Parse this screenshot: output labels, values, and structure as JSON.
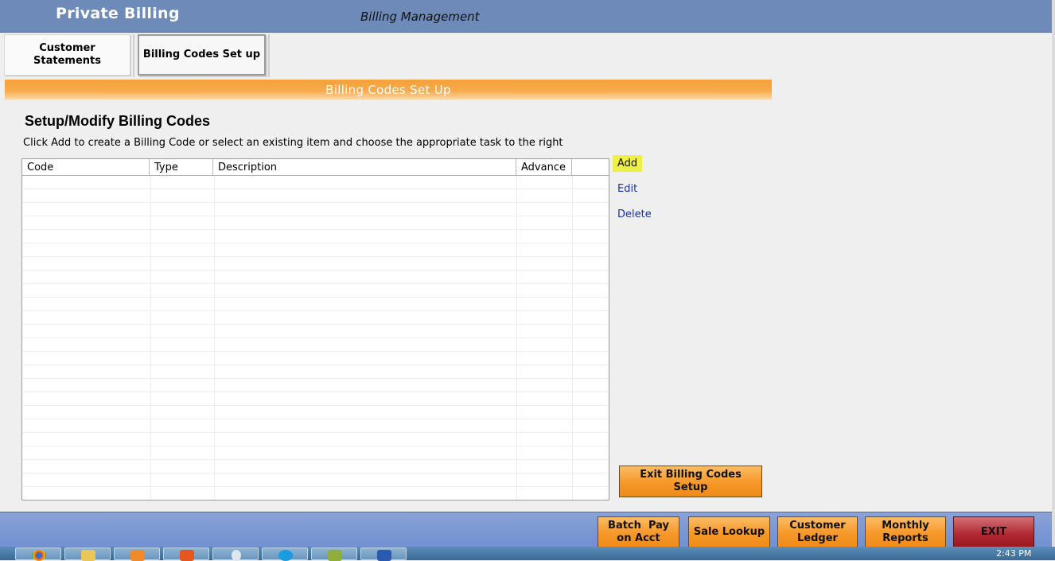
{
  "header": {
    "app_title": "Private Billing",
    "module_title": "Billing Management"
  },
  "tabs": [
    {
      "label": "Customer Statements",
      "line1": "Customer",
      "line2": "Statements",
      "active": false
    },
    {
      "label": "Billing Codes Set up",
      "active": true
    }
  ],
  "section": {
    "banner": "Billing Codes Set Up"
  },
  "page": {
    "heading": "Setup/Modify Billing Codes",
    "instructions": "Click Add to create a Billing Code or select an existing item and choose the appropriate task to the right"
  },
  "grid": {
    "columns": [
      "Code",
      "Type",
      "Description",
      "Advance",
      ""
    ],
    "rows": []
  },
  "actions": {
    "add": "Add",
    "edit": "Edit",
    "delete": "Delete"
  },
  "exit_codes_button": {
    "line1": "Exit Billing Codes",
    "line2": "Setup"
  },
  "footer_buttons": {
    "batch_pay": {
      "line1": "Batch  Pay",
      "line2": "on Acct"
    },
    "sale_lookup": {
      "line1": "Sale Lookup"
    },
    "customer_ledger": {
      "line1": "Customer",
      "line2": "Ledger"
    },
    "monthly_reports": {
      "line1": "Monthly",
      "line2": "Reports"
    },
    "exit": {
      "line1": "EXIT"
    }
  },
  "taskbar": {
    "clock": "2:43 PM",
    "icons": [
      "chrome-icon",
      "explorer-icon",
      "media-player-icon",
      "app-b-icon",
      "search-icon",
      "skype-icon",
      "fen-icon",
      "word-icon"
    ]
  },
  "colors": {
    "header": "#6d8ab9",
    "banner": "#f6a13a",
    "button_orange": "#f69a2c",
    "exit_red": "#b42a33",
    "highlight_add": "#eef04a",
    "link": "#1a32a6"
  }
}
